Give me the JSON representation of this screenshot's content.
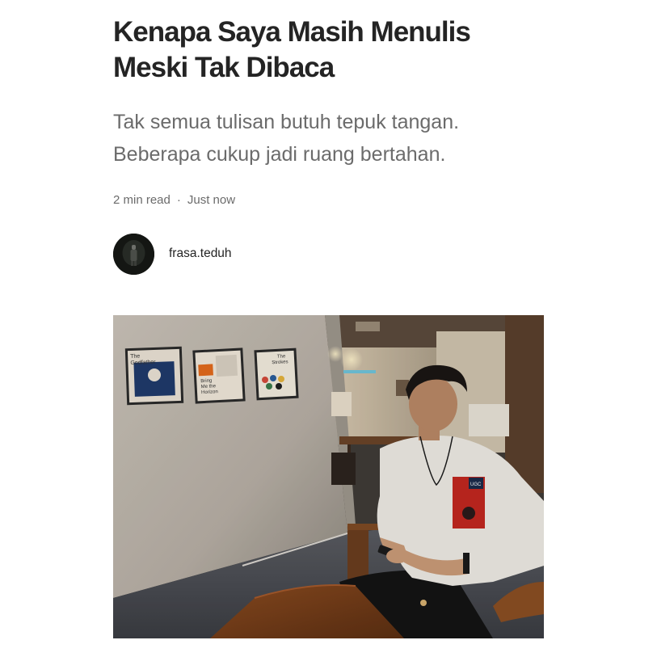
{
  "article": {
    "title": "Kenapa Saya Masih Menulis Meski Tak Dibaca",
    "subtitle": "Tak semua tulisan butuh tepuk tangan. Beberapa cukup jadi ruang bertahan.",
    "read_time": "2 min read",
    "separator": "·",
    "published": "Just now"
  },
  "author": {
    "name": "frasa.teduh",
    "avatar_icon": "user-avatar"
  },
  "hero_image": {
    "posters": [
      {
        "line1": "The",
        "line2": "Godfather"
      },
      {
        "line1": "Bring",
        "line2": "Me the",
        "line3": "Horizon"
      },
      {
        "line1": "The",
        "line2": "Strokes"
      }
    ],
    "shirt_patch": "UGC"
  },
  "colors": {
    "title": "#242424",
    "subtitle": "#6b6b6b",
    "meta": "#6b6b6b"
  }
}
